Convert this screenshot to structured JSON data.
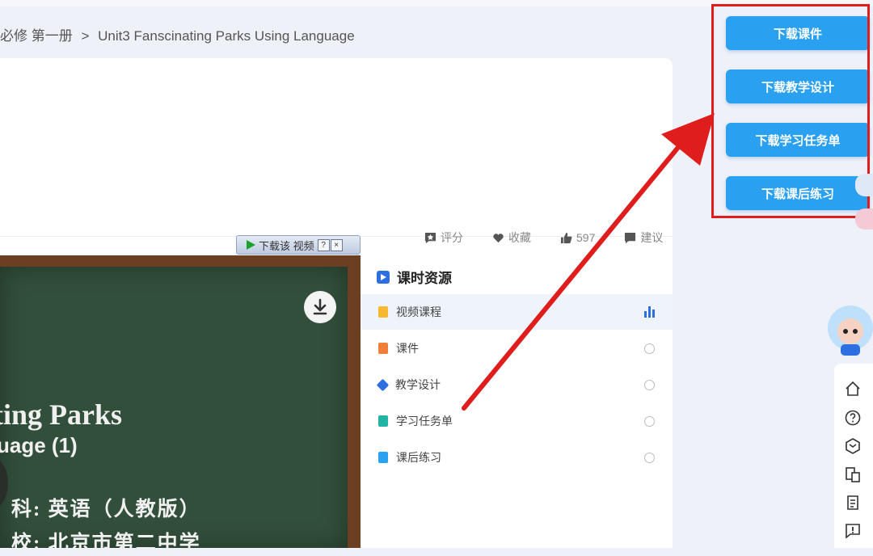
{
  "breadcrumb": {
    "part1": "必修 第一册",
    "sep": ">",
    "part2": "Unit3 Fanscinating Parks Using Language"
  },
  "actions": {
    "rate": "评分",
    "favorite": "收藏",
    "likes": "597",
    "suggest": "建议"
  },
  "video_toolbar": {
    "label": "下载该 视频",
    "help": "?",
    "close": "×"
  },
  "board": {
    "title": "ting Parks",
    "subtitle": "uage (1)",
    "line1": "科: 英语（人教版）",
    "line2": "校: 北京市第二中学"
  },
  "resources": {
    "heading": "课时资源",
    "items": [
      {
        "label": "视频课程",
        "icon_color": "#f5b82e",
        "active": true
      },
      {
        "label": "课件",
        "icon_color": "#f07d3a"
      },
      {
        "label": "教学设计",
        "icon_color": "#2d6fe0"
      },
      {
        "label": "学习任务单",
        "icon_color": "#22b5a6"
      },
      {
        "label": "课后练习",
        "icon_color": "#2aa0f0"
      }
    ]
  },
  "download_buttons": {
    "courseware": "下载课件",
    "teaching_design": "下载教学设计",
    "task_sheet": "下载学习任务单",
    "exercise": "下载课后练习"
  },
  "colors": {
    "primary": "#2aa0f0",
    "highlight_red": "#e01d1d",
    "board_green": "#324f3b"
  }
}
